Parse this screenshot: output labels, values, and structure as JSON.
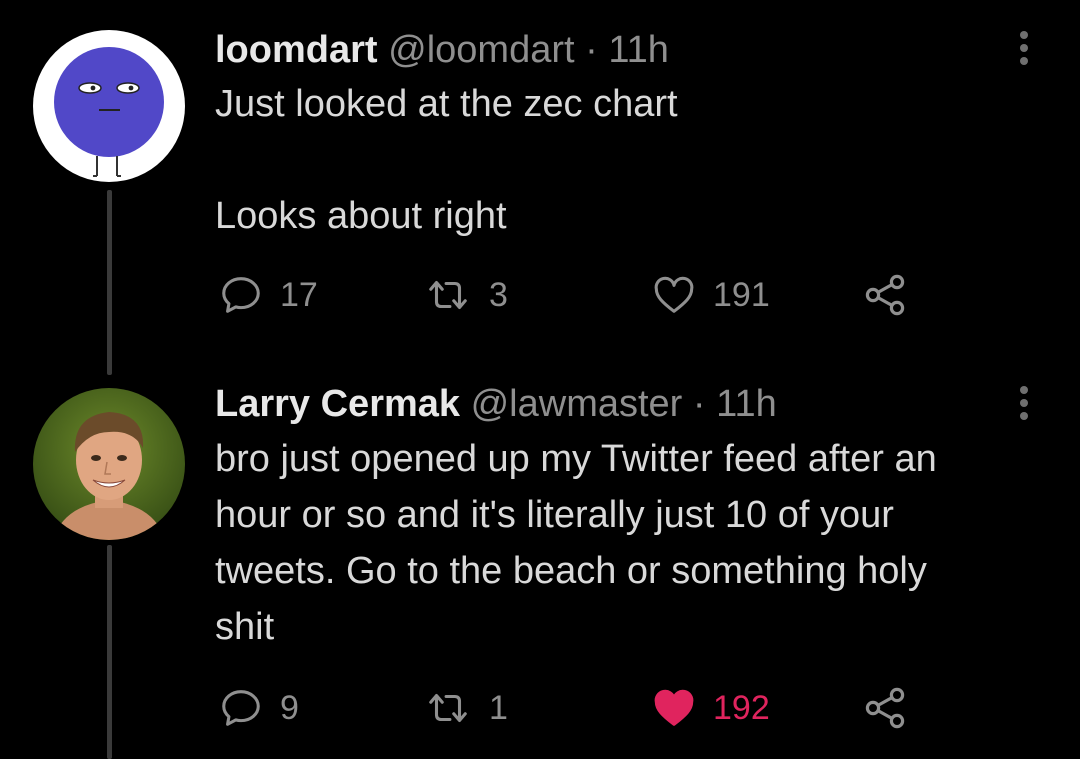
{
  "tweets": [
    {
      "name": "loomdart",
      "handle": "@loomdart",
      "separator": "·",
      "time": "11h",
      "text": "Just looked at the zec chart\n\nLooks about right",
      "reply_count": "17",
      "retweet_count": "3",
      "like_count": "191",
      "liked": false,
      "avatar_icon": "blue-face-avatar"
    },
    {
      "name": "Larry Cermak",
      "handle": "@lawmaster",
      "separator": "·",
      "time": "11h",
      "text": "bro just opened up my Twitter feed after an\nhour or so and it's literally just 10 of your\ntweets. Go to the beach or something holy\nshit",
      "reply_count": "9",
      "retweet_count": "1",
      "like_count": "192",
      "liked": true,
      "avatar_icon": "portrait-photo-avatar"
    }
  ],
  "colors": {
    "background": "#000000",
    "text": "#d9d9d9",
    "secondary": "#8f8f8f",
    "like": "#e0245e",
    "thread_line": "#3a3a3a"
  }
}
